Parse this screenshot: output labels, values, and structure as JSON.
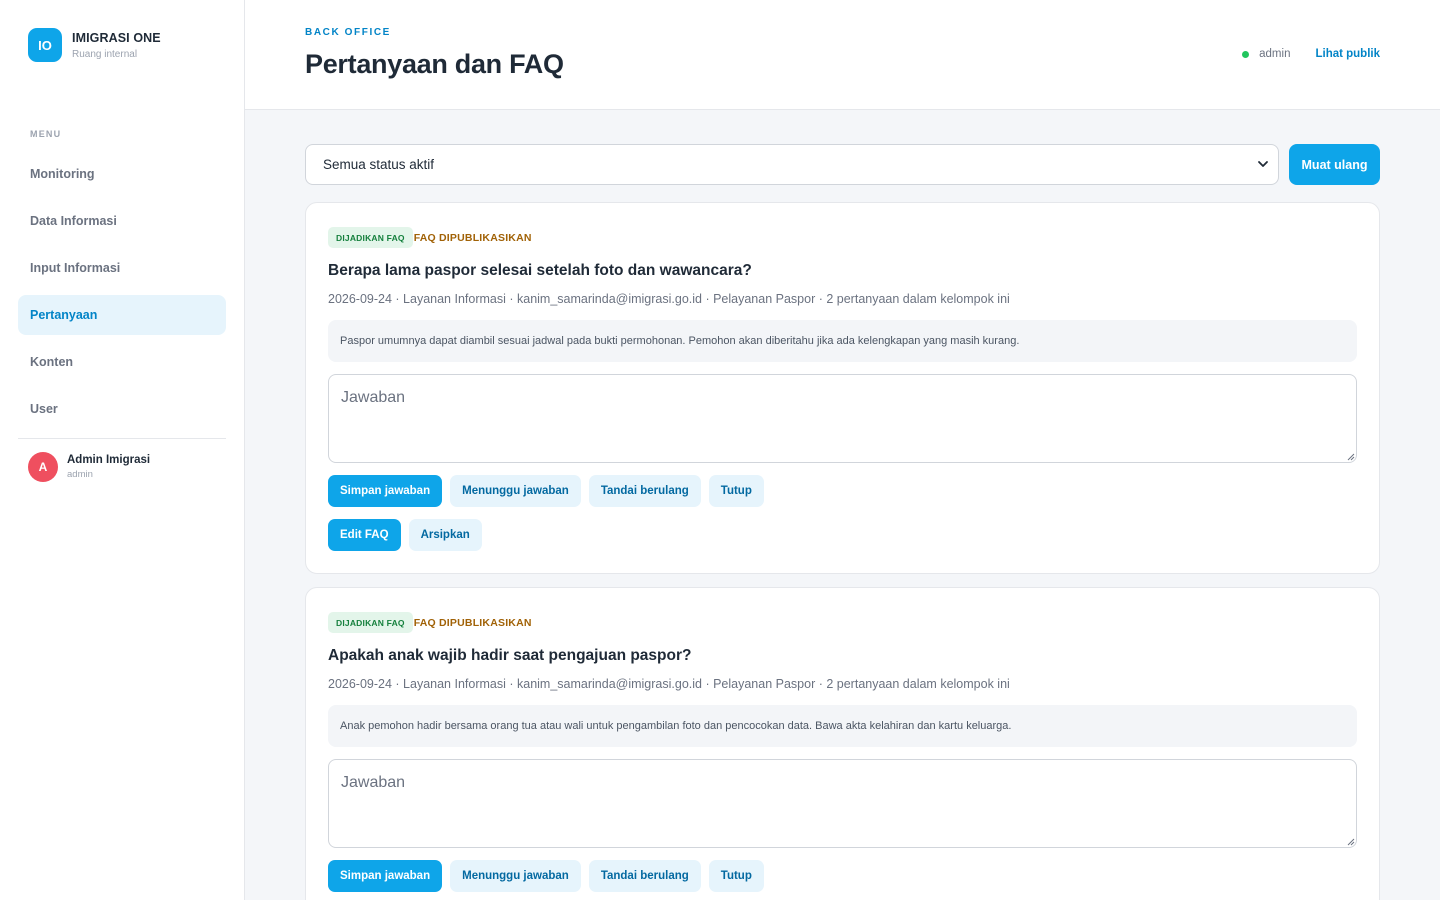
{
  "brand": {
    "logo": "IO",
    "title": "IMIGRASI ONE",
    "subtitle": "Ruang internal"
  },
  "sidebar": {
    "menu_label": "MENU",
    "items": [
      {
        "label": "Monitoring",
        "active": false
      },
      {
        "label": "Data Informasi",
        "active": false
      },
      {
        "label": "Input Informasi",
        "active": false
      },
      {
        "label": "Pertanyaan",
        "active": true
      },
      {
        "label": "Konten",
        "active": false
      },
      {
        "label": "User",
        "active": false
      }
    ],
    "user": {
      "initial": "A",
      "name": "Admin Imigrasi",
      "role": "admin"
    }
  },
  "header": {
    "eyebrow": "BACK OFFICE",
    "title": "Pertanyaan dan FAQ",
    "status_user": "admin",
    "public_link": "Lihat publik"
  },
  "filter": {
    "selected": "Semua status aktif",
    "reload_label": "Muat ulang"
  },
  "questions": [
    {
      "badge_faq": "DIJADIKAN FAQ",
      "badge_status": "FAQ DIPUBLIKASIKAN",
      "title": "Berapa lama paspor selesai setelah foto dan wawancara?",
      "meta": "2026-09-24 · Layanan Informasi · kanim_samarinda@imigrasi.go.id · Pelayanan Paspor · 2 pertanyaan dalam kelompok ini",
      "description": "Paspor umumnya dapat diambil sesuai jadwal pada bukti permohonan. Pemohon akan diberitahu jika ada kelengkapan yang masih kurang.",
      "answer_placeholder": "Jawaban",
      "actions": {
        "save": "Simpan jawaban",
        "waiting": "Menunggu jawaban",
        "duplicate": "Tandai berulang",
        "close": "Tutup"
      },
      "faq_actions": {
        "edit": "Edit FAQ",
        "archive": "Arsipkan"
      }
    },
    {
      "badge_faq": "DIJADIKAN FAQ",
      "badge_status": "FAQ DIPUBLIKASIKAN",
      "title": "Apakah anak wajib hadir saat pengajuan paspor?",
      "meta": "2026-09-24 · Layanan Informasi · kanim_samarinda@imigrasi.go.id · Pelayanan Paspor · 2 pertanyaan dalam kelompok ini",
      "description": "Anak pemohon hadir bersama orang tua atau wali untuk pengambilan foto dan pencocokan data. Bawa akta kelahiran dan kartu keluarga.",
      "answer_placeholder": "Jawaban",
      "actions": {
        "save": "Simpan jawaban",
        "waiting": "Menunggu jawaban",
        "duplicate": "Tandai berulang",
        "close": "Tutup"
      }
    }
  ],
  "colors": {
    "accent": "#0ea5e9",
    "accent_dark": "#0284c7",
    "active_bg": "#e6f4fc",
    "status_online": "#22c55e",
    "faq_badge_bg": "#e3f5ea",
    "published": "#a16207",
    "avatar": "#ef4f5f"
  }
}
